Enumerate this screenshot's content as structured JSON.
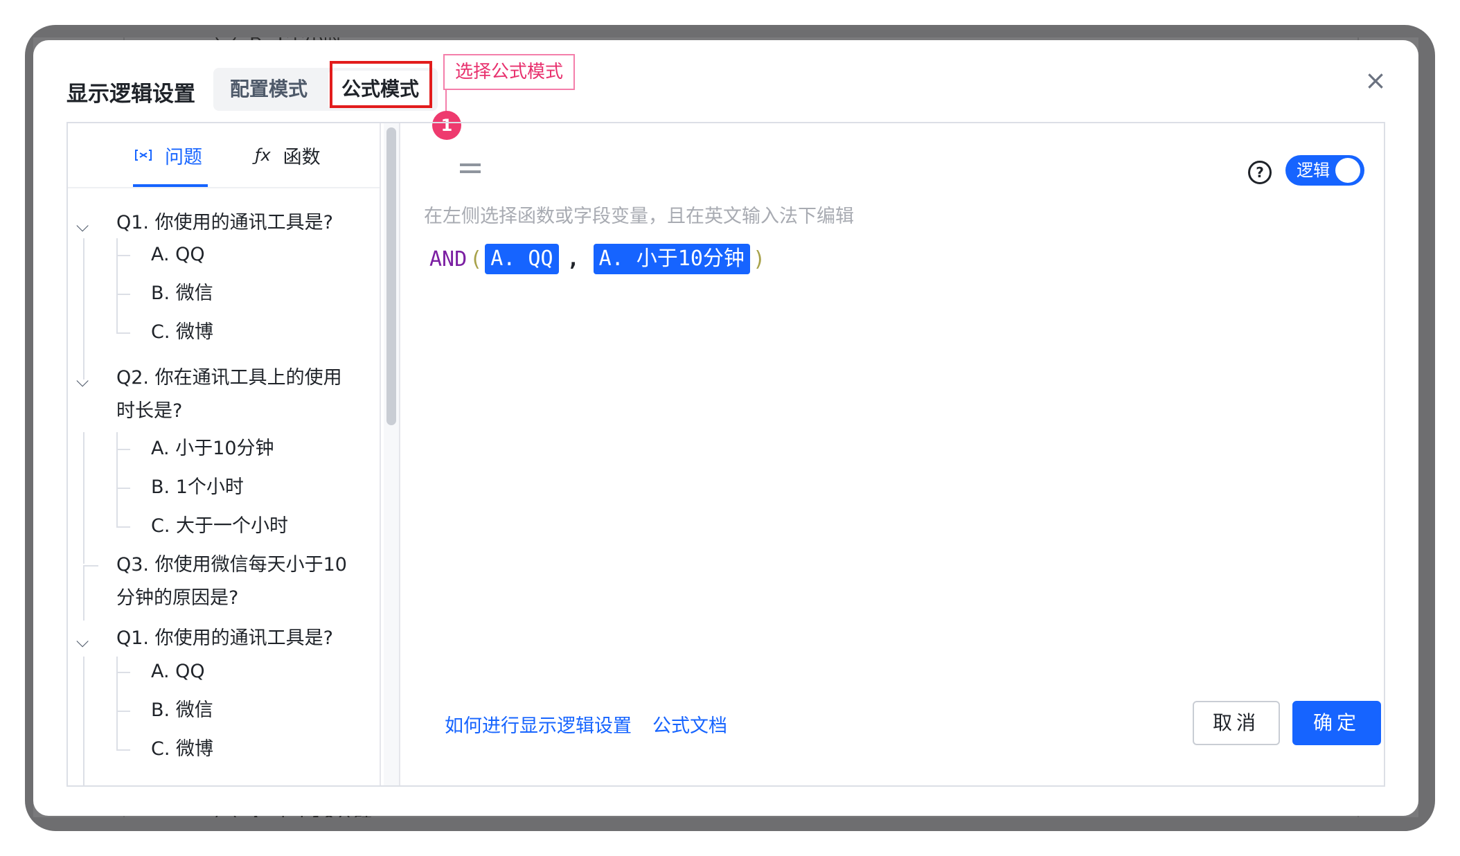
{
  "background": {
    "top_item": "B. 1个小时",
    "bottom_item": "A. 小于10分钟"
  },
  "dialog": {
    "title": "显示逻辑设置",
    "modes": [
      "配置模式",
      "公式模式"
    ],
    "active_mode": "公式模式",
    "annotation": "选择公式模式",
    "badge": "1",
    "close": "×"
  },
  "left_panel": {
    "tabs": [
      {
        "label": "问题",
        "icon": "variable-icon"
      },
      {
        "label": "函数",
        "icon": "function-icon",
        "icon_glyph": "ƒx"
      }
    ],
    "tree": {
      "q1": "Q1. 你使用的通讯工具是?",
      "q1_opts": [
        "A. QQ",
        "B. 微信",
        "C. 微博"
      ],
      "q2_line1": "Q2. 你在通讯工具上的使用",
      "q2_line2": "时长是?",
      "q2_opts": [
        "A. 小于10分钟",
        "B. 1个小时",
        "C. 大于一个小时"
      ],
      "q3_line1": "Q3. 你使用微信每天小于10",
      "q3_line2": "分钟的原因是?",
      "q1b": "Q1. 你使用的通讯工具是?",
      "q1b_opts": [
        "A. QQ",
        "B. 微信",
        "C. 微博"
      ]
    }
  },
  "editor": {
    "help": "?",
    "toggle_label": "逻辑",
    "hint": "在左侧选择函数或字段变量，且在英文输入法下编辑",
    "formula": {
      "fn": "AND",
      "open": "(",
      "arg1": "A. QQ",
      "comma": ",",
      "arg2": "A. 小于10分钟",
      "close": ")"
    }
  },
  "footer": {
    "link1": "如何进行显示逻辑设置",
    "link2": "公式文档",
    "cancel": "取消",
    "ok": "确定"
  },
  "colors": {
    "accent": "#1664ff",
    "highlight": "#e21c1c",
    "annotation": "#e8316e"
  }
}
